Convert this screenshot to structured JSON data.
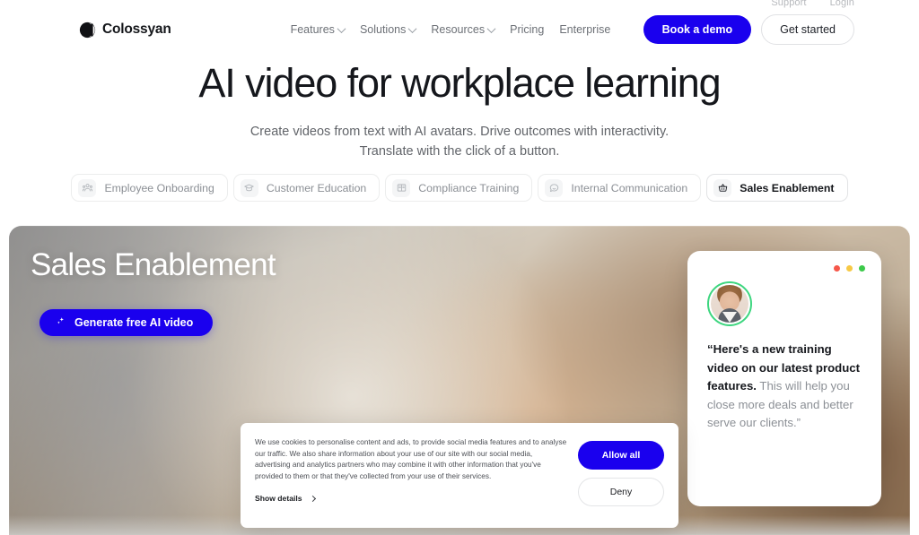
{
  "brand": {
    "name": "Colossyan",
    "logo_icon": "colossyan-circle-logo",
    "accent_blue": "#1a00ee",
    "accent_green": "#3dd67f"
  },
  "utility_bar": {
    "links": [
      {
        "label": "Support",
        "name": "support-link"
      },
      {
        "label": "Login",
        "name": "login-link"
      }
    ]
  },
  "header": {
    "nav": [
      {
        "label": "Features",
        "has_dropdown": true
      },
      {
        "label": "Solutions",
        "has_dropdown": true
      },
      {
        "label": "Resources",
        "has_dropdown": true
      },
      {
        "label": "Pricing",
        "has_dropdown": false
      },
      {
        "label": "Enterprise",
        "has_dropdown": false
      }
    ],
    "book_demo_label": "Book a demo",
    "get_started_label": "Get started"
  },
  "hero": {
    "title": "AI video for workplace learning",
    "subtitle_line1": "Create videos from text with AI avatars. Drive outcomes with interactivity.",
    "subtitle_line2": "Translate with the click of a button."
  },
  "tabs": {
    "active_index": 4,
    "items": [
      {
        "label": "Employee Onboarding",
        "icon": "people-group-icon"
      },
      {
        "label": "Customer Education",
        "icon": "graduation-cap-icon"
      },
      {
        "label": "Compliance Training",
        "icon": "open-book-icon"
      },
      {
        "label": "Internal Communication",
        "icon": "speech-bubble-icon"
      },
      {
        "label": "Sales Enablement",
        "icon": "shopping-basket-icon"
      }
    ]
  },
  "banner": {
    "title": "Sales Enablement",
    "cta_label": "Generate free AI video",
    "cta_icon": "sparkle-icon",
    "image_alt": "handshake-photo"
  },
  "quote_card": {
    "window_dots": [
      "#f6574a",
      "#f7c945",
      "#3cc94a"
    ],
    "avatar_alt": "presenter-avatar",
    "quote_bold": "“Here's a new training video on our latest product features.",
    "quote_rest": " This will help you close more deals and better serve our clients.”"
  },
  "cookie_banner": {
    "body": "We use cookies to personalise content and ads, to provide social media features and to analyse our traffic. We also share information about your use of our site with our social media, advertising and analytics partners who may combine it with other information that you've provided to them or that they've collected from your use of their services.",
    "show_details_label": "Show details",
    "allow_label": "Allow all",
    "deny_label": "Deny"
  }
}
